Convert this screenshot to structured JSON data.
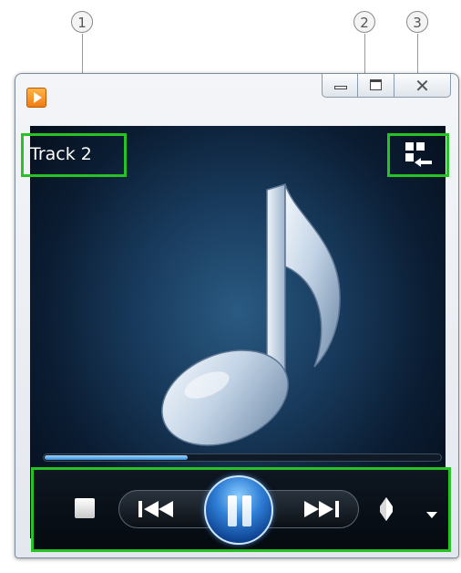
{
  "callouts": [
    "1",
    "2",
    "3"
  ],
  "now_playing": {
    "track_title": "Track 2",
    "seek_progress": 0.36
  },
  "icons": {
    "app": "media-player-icon",
    "switch_view": "switch-to-library-icon",
    "media": "music-note-icon",
    "stop": "stop-icon",
    "previous": "previous-track-icon",
    "play_pause": "pause-icon",
    "next": "next-track-icon",
    "volume": "volume-icon",
    "more": "chevron-down-icon"
  },
  "colors": {
    "highlight": "#26c226",
    "accent": "#2f7fd6",
    "viewport_bg": "#0b1d33"
  }
}
